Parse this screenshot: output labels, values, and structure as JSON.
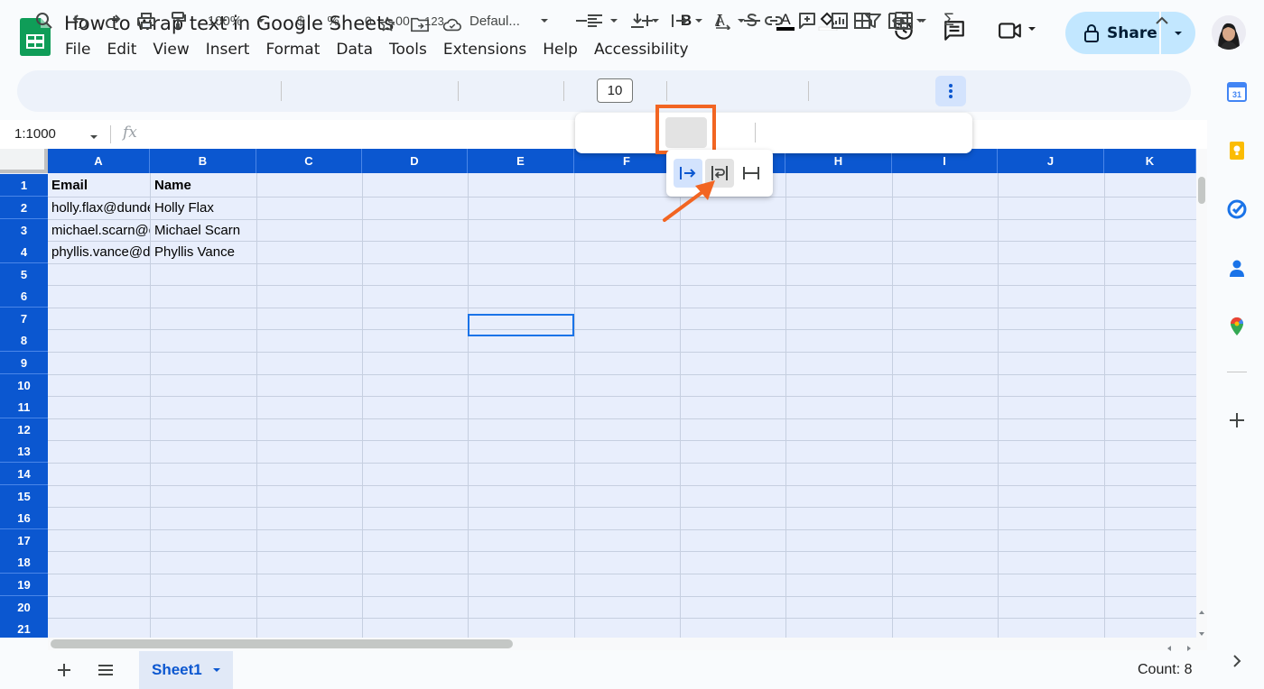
{
  "document": {
    "title": "How to wrap text in Google Sheets"
  },
  "menu": [
    "File",
    "Edit",
    "View",
    "Insert",
    "Format",
    "Data",
    "Tools",
    "Extensions",
    "Help",
    "Accessibility"
  ],
  "header": {
    "share_label": "Share"
  },
  "toolbar": {
    "zoom": "100%",
    "currency": "$",
    "percent": "%",
    "decrease_decimal": ".0",
    "increase_decimal": ".00",
    "number_format": "123",
    "font": "Defaul...",
    "font_size": "10",
    "bold": "B",
    "italic": "I",
    "text_color": "A"
  },
  "formula_bar": {
    "name_box": "1:1000",
    "fx": "fx"
  },
  "columns": [
    "A",
    "B",
    "C",
    "D",
    "E",
    "F",
    "G",
    "H",
    "I",
    "J",
    "K"
  ],
  "rows": [
    "1",
    "2",
    "3",
    "4",
    "5",
    "6",
    "7",
    "8",
    "9",
    "10",
    "11",
    "12",
    "13",
    "14",
    "15",
    "16",
    "17",
    "18",
    "19",
    "20",
    "21"
  ],
  "cells": {
    "a1": "Email",
    "b1": "Name",
    "a2": "holly.flax@dundermifflin.com",
    "b2": "Holly Flax",
    "a3": "michael.scarn@dundermifflin.com",
    "b3": "Michael Scarn",
    "a4": "phyllis.vance@dundermifflin.com",
    "b4": "Phyllis Vance"
  },
  "popup": {
    "sum": "Σ",
    "text_color": "A"
  },
  "bottom": {
    "sheet_name": "Sheet1",
    "count": "Count: 8"
  },
  "colors": {
    "header_blue": "#0b57d0",
    "selection_fill": "#e8eefc",
    "highlight_orange": "#f26522",
    "share_bg": "#c2e7ff"
  }
}
